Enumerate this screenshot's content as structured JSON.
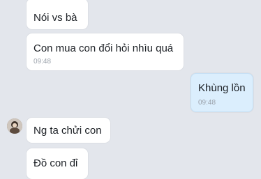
{
  "messages": [
    {
      "text": "Nói vs bà",
      "time": ""
    },
    {
      "text": "Con mua con đổi hỏi nhìu quá",
      "time": "09:48"
    },
    {
      "text": "Khùng lồn",
      "time": "09:48"
    },
    {
      "text": "Ng ta chửi con",
      "time": ""
    },
    {
      "text": "Đồ con đỉ",
      "time": ""
    }
  ]
}
